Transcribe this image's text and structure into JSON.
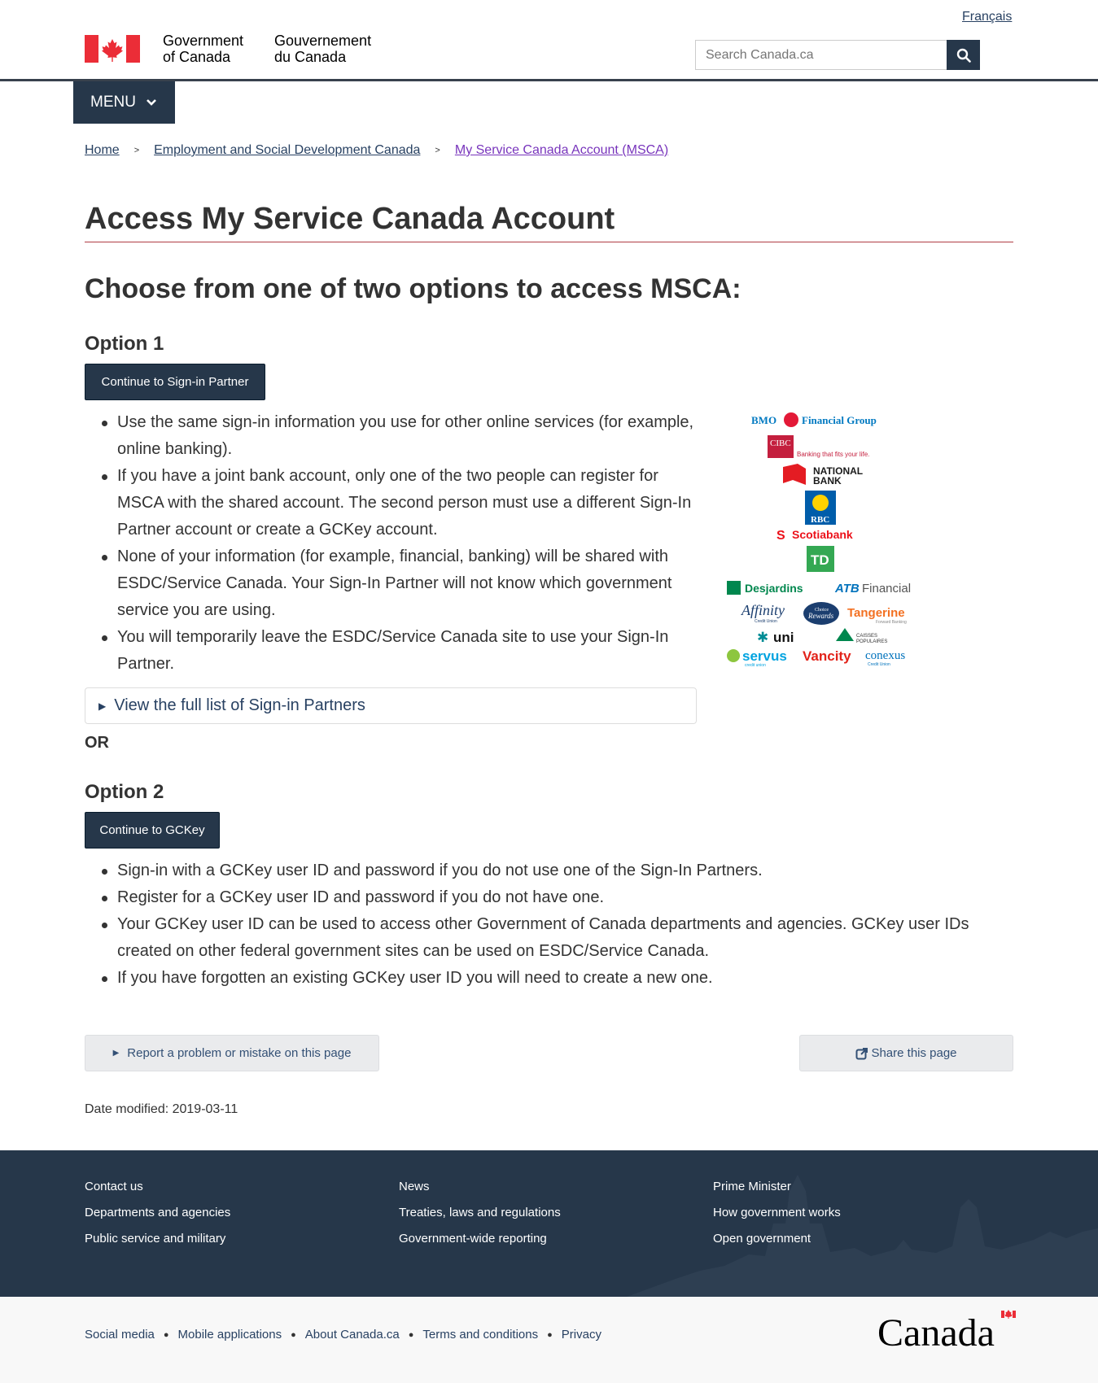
{
  "header": {
    "lang_toggle": "Français",
    "sig_en_line1": "Government",
    "sig_en_line2": "of Canada",
    "sig_fr_line1": "Gouvernement",
    "sig_fr_line2": "du Canada",
    "search_placeholder": "Search Canada.ca",
    "menu_label": "MENU"
  },
  "breadcrumb": [
    "Home",
    "Employment and Social Development Canada",
    "My Service Canada Account (MSCA)"
  ],
  "page_title": "Access My Service Canada Account",
  "sub_title": "Choose from one of two options to access MSCA:",
  "option1": {
    "heading": "Option 1",
    "button": "Continue to Sign-in Partner",
    "bullets": [
      "Use the same sign-in information you use for other online services (for example, online banking).",
      "If you have a joint bank account, only one of the two people can register for MSCA with the shared account. The second person must use a different Sign-In Partner account or create a GCKey account.",
      "None of your information (for example, financial, banking) will be shared with ESDC/Service Canada. Your Sign-In Partner will not know which government service you are using.",
      "You will temporarily leave the ESDC/Service Canada site to use your Sign-In Partner."
    ],
    "details_summary": "View the full list of Sign-in Partners"
  },
  "or_text": "OR",
  "option2": {
    "heading": "Option 2",
    "button": "Continue to GCKey",
    "bullets": [
      "Sign-in with a GCKey user ID and password if you do not use one of the Sign-In Partners.",
      "Register for a GCKey user ID and password if you do not have one.",
      "Your GCKey user ID can be used to access other Government of Canada departments and agencies. GCKey user IDs created on other federal government sites can be used on ESDC/Service Canada.",
      "If you have forgotten an existing GCKey user ID you will need to create a new one."
    ]
  },
  "bank_logos": {
    "bmo_a": "BMO",
    "bmo_b": "Financial Group",
    "cibc": "CIBC",
    "cibc_tagline": "Banking that fits your life.",
    "national_a": "NATIONAL",
    "national_b": "BANK",
    "rbc": "RBC",
    "scotiabank": "Scotiabank",
    "td": "TD",
    "desjardins": "Desjardins",
    "atb_a": "ATB",
    "atb_b": "Financial",
    "affinity": "Affinity",
    "affinity_sub": "Credit Union",
    "choice_a": "Choice",
    "choice_b": "Rewards",
    "tangerine": "Tangerine",
    "tangerine_sub": "Forward Banking",
    "uni": "uni",
    "caisses_a": "CAISSES",
    "caisses_b": "POPULAIRES",
    "servus": "servus",
    "servus_sub": "credit union",
    "vancity": "Vancity",
    "conexus": "conexus",
    "conexus_sub": "Credit Union"
  },
  "report_button": "Report a problem or mistake on this page",
  "share_button": "Share this page",
  "date_modified": "Date modified: 2019-03-11",
  "footer": {
    "col1": [
      "Contact us",
      "Departments and agencies",
      "Public service and military"
    ],
    "col2": [
      "News",
      "Treaties, laws and regulations",
      "Government-wide reporting"
    ],
    "col3": [
      "Prime Minister",
      "How government works",
      "Open government"
    ],
    "bottom_links": [
      "Social media",
      "Mobile applications",
      "About Canada.ca",
      "Terms and conditions",
      "Privacy"
    ],
    "wordmark": "Canada"
  },
  "colors": {
    "header_blue": "#26374a",
    "link": "#284162",
    "visited": "#7834bc",
    "title_rule": "#af3c43",
    "canada_red": "#eb2d37"
  }
}
